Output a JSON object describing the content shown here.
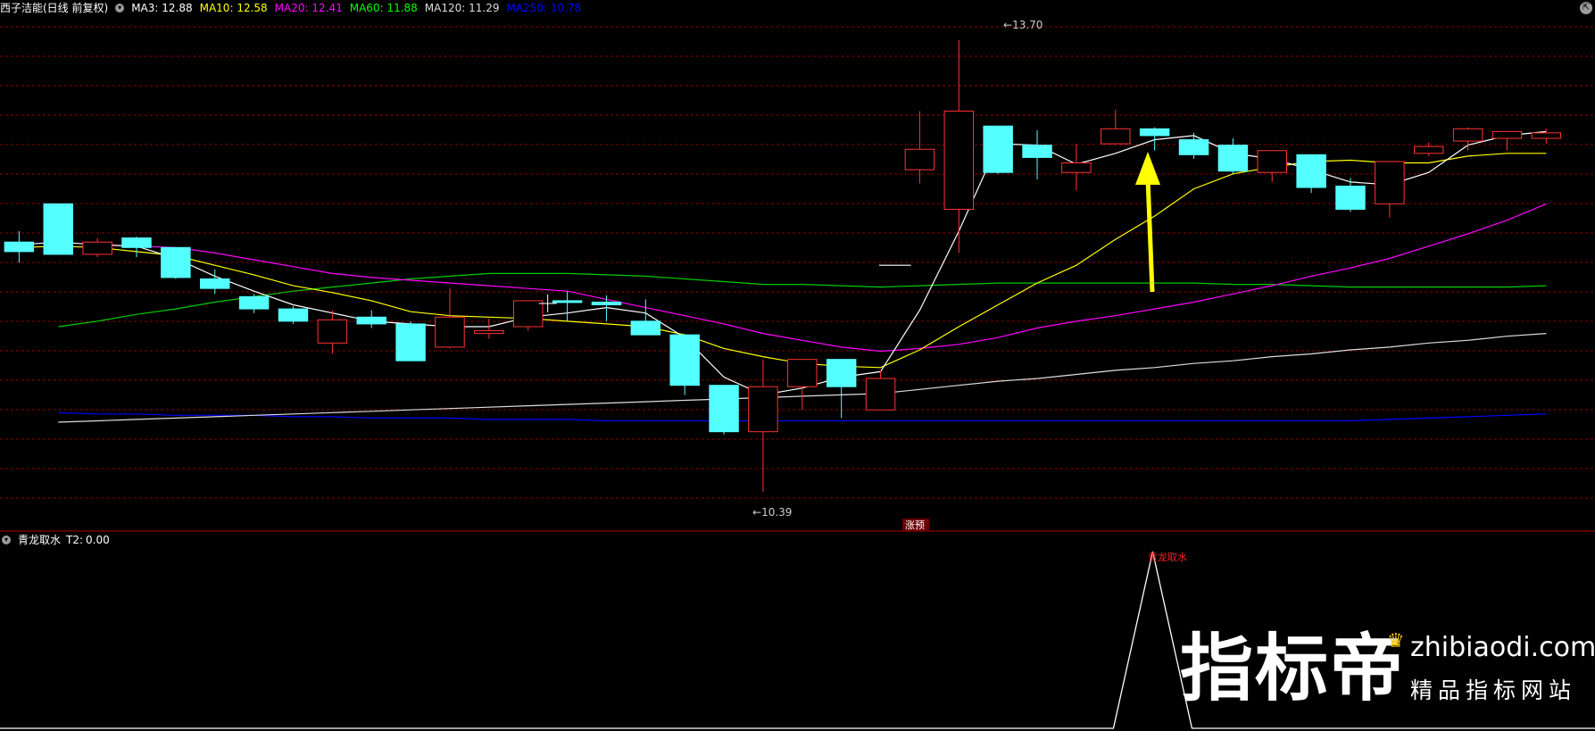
{
  "header": {
    "title": "西子洁能(日线 前复权)",
    "ma": [
      {
        "label": "MA3:",
        "value": "12.88",
        "color": "#ffffff"
      },
      {
        "label": "MA10:",
        "value": "12.58",
        "color": "#ffff00"
      },
      {
        "label": "MA20:",
        "value": "12.41",
        "color": "#ff00ff"
      },
      {
        "label": "MA60:",
        "value": "11.88",
        "color": "#00ff00"
      },
      {
        "label": "MA120:",
        "value": "11.29",
        "color": "#dddddd"
      },
      {
        "label": "MA250:",
        "value": "10.78",
        "color": "#0000ff"
      }
    ],
    "corner_icon": "restore-icon"
  },
  "sub_header": {
    "name": "青龙取水",
    "t2_label": "T2:",
    "t2_value": "0.00"
  },
  "annotations": {
    "high_label": "13.70",
    "low_label": "10.39",
    "marker_label": "涨预",
    "signal_label": "青龙取水"
  },
  "watermark": {
    "brand": "指标帝",
    "url": "zhibiaodi.com",
    "tagline": "精品指标网站",
    "crown_icon": "crown-icon"
  },
  "colors": {
    "up": "#ff3333",
    "down": "#54ffff",
    "grid": "#8b0000",
    "ma3": "#ffffff",
    "ma10": "#ffff00",
    "ma20": "#ff00ff",
    "ma60": "#00cc00",
    "ma120": "#dddddd",
    "ma250": "#0000ff",
    "arrow": "#ffff00",
    "signal": "#ffffff",
    "signal_text": "#ff2020"
  },
  "chart_data": {
    "type": "candlestick",
    "ylim": [
      10.2,
      13.85
    ],
    "grid": "horizontal dashed",
    "candles": [
      {
        "o": 12.22,
        "h": 12.3,
        "l": 12.07,
        "c": 12.15
      },
      {
        "o": 12.5,
        "h": 12.5,
        "l": 12.13,
        "c": 12.13
      },
      {
        "o": 12.13,
        "h": 12.25,
        "l": 12.11,
        "c": 12.22
      },
      {
        "o": 12.25,
        "h": 12.26,
        "l": 12.11,
        "c": 12.18
      },
      {
        "o": 12.18,
        "h": 12.18,
        "l": 11.95,
        "c": 11.96
      },
      {
        "o": 11.95,
        "h": 12.02,
        "l": 11.84,
        "c": 11.88
      },
      {
        "o": 11.82,
        "h": 11.84,
        "l": 11.7,
        "c": 11.73
      },
      {
        "o": 11.73,
        "h": 11.75,
        "l": 11.62,
        "c": 11.64
      },
      {
        "o": 11.48,
        "h": 11.72,
        "l": 11.4,
        "c": 11.65
      },
      {
        "o": 11.67,
        "h": 11.72,
        "l": 11.59,
        "c": 11.62
      },
      {
        "o": 11.62,
        "h": 11.64,
        "l": 11.35,
        "c": 11.35
      },
      {
        "o": 11.45,
        "h": 11.88,
        "l": 11.44,
        "c": 11.67
      },
      {
        "o": 11.55,
        "h": 11.66,
        "l": 11.51,
        "c": 11.57
      },
      {
        "o": 11.6,
        "h": 11.79,
        "l": 11.57,
        "c": 11.79
      },
      {
        "o": 11.79,
        "h": 11.86,
        "l": 11.64,
        "c": 11.78
      },
      {
        "o": 11.78,
        "h": 11.83,
        "l": 11.64,
        "c": 11.76
      },
      {
        "o": 11.64,
        "h": 11.8,
        "l": 11.54,
        "c": 11.54
      },
      {
        "o": 11.54,
        "h": 11.54,
        "l": 11.1,
        "c": 11.17
      },
      {
        "o": 11.17,
        "h": 11.17,
        "l": 10.81,
        "c": 10.83
      },
      {
        "o": 10.83,
        "h": 11.36,
        "l": 10.39,
        "c": 11.16
      },
      {
        "o": 11.16,
        "h": 11.36,
        "l": 10.99,
        "c": 11.36
      },
      {
        "o": 11.36,
        "h": 11.36,
        "l": 10.93,
        "c": 11.16
      },
      {
        "o": 10.99,
        "h": 11.28,
        "l": 10.99,
        "c": 11.22
      },
      {
        "o": 12.75,
        "h": 13.18,
        "l": 12.65,
        "c": 12.9
      },
      {
        "o": 12.46,
        "h": 13.7,
        "l": 12.14,
        "c": 13.18
      },
      {
        "o": 13.07,
        "h": 13.07,
        "l": 12.72,
        "c": 12.73
      },
      {
        "o": 12.93,
        "h": 13.04,
        "l": 12.68,
        "c": 12.84
      },
      {
        "o": 12.73,
        "h": 12.94,
        "l": 12.6,
        "c": 12.8
      },
      {
        "o": 12.94,
        "h": 13.19,
        "l": 12.94,
        "c": 13.05
      },
      {
        "o": 13.05,
        "h": 13.06,
        "l": 12.89,
        "c": 13.0
      },
      {
        "o": 12.97,
        "h": 13.02,
        "l": 12.83,
        "c": 12.86
      },
      {
        "o": 12.93,
        "h": 12.98,
        "l": 12.72,
        "c": 12.74
      },
      {
        "o": 12.73,
        "h": 12.89,
        "l": 12.66,
        "c": 12.89
      },
      {
        "o": 12.86,
        "h": 12.86,
        "l": 12.58,
        "c": 12.62
      },
      {
        "o": 12.63,
        "h": 12.69,
        "l": 12.44,
        "c": 12.46
      },
      {
        "o": 12.5,
        "h": 12.75,
        "l": 12.4,
        "c": 12.81
      },
      {
        "o": 12.87,
        "h": 12.95,
        "l": 12.85,
        "c": 12.92
      },
      {
        "o": 12.96,
        "h": 13.06,
        "l": 12.89,
        "c": 13.05
      },
      {
        "o": 12.98,
        "h": 13.03,
        "l": 12.89,
        "c": 13.03
      },
      {
        "o": 12.98,
        "h": 13.05,
        "l": 12.94,
        "c": 13.02
      }
    ],
    "ma3": [
      12.2,
      12.22,
      12.2,
      12.19,
      12.1,
      11.97,
      11.86,
      11.76,
      11.7,
      11.64,
      11.62,
      11.6,
      11.6,
      11.67,
      11.7,
      11.74,
      11.7,
      11.52,
      11.23,
      11.1,
      11.15,
      11.23,
      11.27,
      11.72,
      12.3,
      12.94,
      12.93,
      12.79,
      12.87,
      12.97,
      13.0,
      12.87,
      12.83,
      12.75,
      12.66,
      12.64,
      12.73,
      12.93,
      13.0,
      13.03
    ],
    "ma10": [
      12.18,
      12.19,
      12.18,
      12.15,
      12.12,
      12.05,
      11.98,
      11.9,
      11.85,
      11.79,
      11.71,
      11.68,
      11.67,
      11.66,
      11.64,
      11.62,
      11.6,
      11.54,
      11.44,
      11.38,
      11.33,
      11.31,
      11.3,
      11.43,
      11.6,
      11.76,
      11.92,
      12.05,
      12.24,
      12.41,
      12.61,
      12.72,
      12.77,
      12.81,
      12.82,
      12.8,
      12.8,
      12.85,
      12.87,
      12.87
    ],
    "ma20": [
      null,
      null,
      12.2,
      12.19,
      12.18,
      12.14,
      12.09,
      12.04,
      11.99,
      11.96,
      11.94,
      11.92,
      11.9,
      11.88,
      11.86,
      11.8,
      11.74,
      11.68,
      11.62,
      11.55,
      11.5,
      11.45,
      11.42,
      11.44,
      11.47,
      11.52,
      11.59,
      11.64,
      11.68,
      11.73,
      11.78,
      11.84,
      11.9,
      11.97,
      12.03,
      12.1,
      12.19,
      12.28,
      12.38,
      12.5
    ],
    "ma60": [
      null,
      11.6,
      11.64,
      11.69,
      11.73,
      11.78,
      11.82,
      11.86,
      11.89,
      11.92,
      11.95,
      11.97,
      11.99,
      11.99,
      11.99,
      11.98,
      11.97,
      11.95,
      11.93,
      11.91,
      11.91,
      11.9,
      11.89,
      11.9,
      11.91,
      11.92,
      11.92,
      11.92,
      11.92,
      11.92,
      11.92,
      11.91,
      11.91,
      11.9,
      11.89,
      11.89,
      11.89,
      11.89,
      11.89,
      11.9
    ],
    "ma120": [
      null,
      10.9,
      10.91,
      10.92,
      10.93,
      10.94,
      10.95,
      10.96,
      10.97,
      10.98,
      10.99,
      11.0,
      11.01,
      11.02,
      11.03,
      11.04,
      11.05,
      11.06,
      11.07,
      11.08,
      11.09,
      11.1,
      11.11,
      11.14,
      11.17,
      11.2,
      11.22,
      11.25,
      11.28,
      11.3,
      11.33,
      11.35,
      11.38,
      11.4,
      11.43,
      11.45,
      11.48,
      11.5,
      11.53,
      11.55
    ],
    "ma250": [
      null,
      10.97,
      10.96,
      10.96,
      10.95,
      10.95,
      10.95,
      10.94,
      10.94,
      10.93,
      10.93,
      10.93,
      10.92,
      10.92,
      10.92,
      10.91,
      10.91,
      10.91,
      10.91,
      10.91,
      10.91,
      10.91,
      10.91,
      10.91,
      10.91,
      10.91,
      10.91,
      10.91,
      10.91,
      10.91,
      10.91,
      10.91,
      10.91,
      10.91,
      10.91,
      10.92,
      10.93,
      10.94,
      10.95,
      10.96
    ],
    "signal_index": 29,
    "gap_marker_price": 12.05,
    "gap_marker_index": 23
  }
}
